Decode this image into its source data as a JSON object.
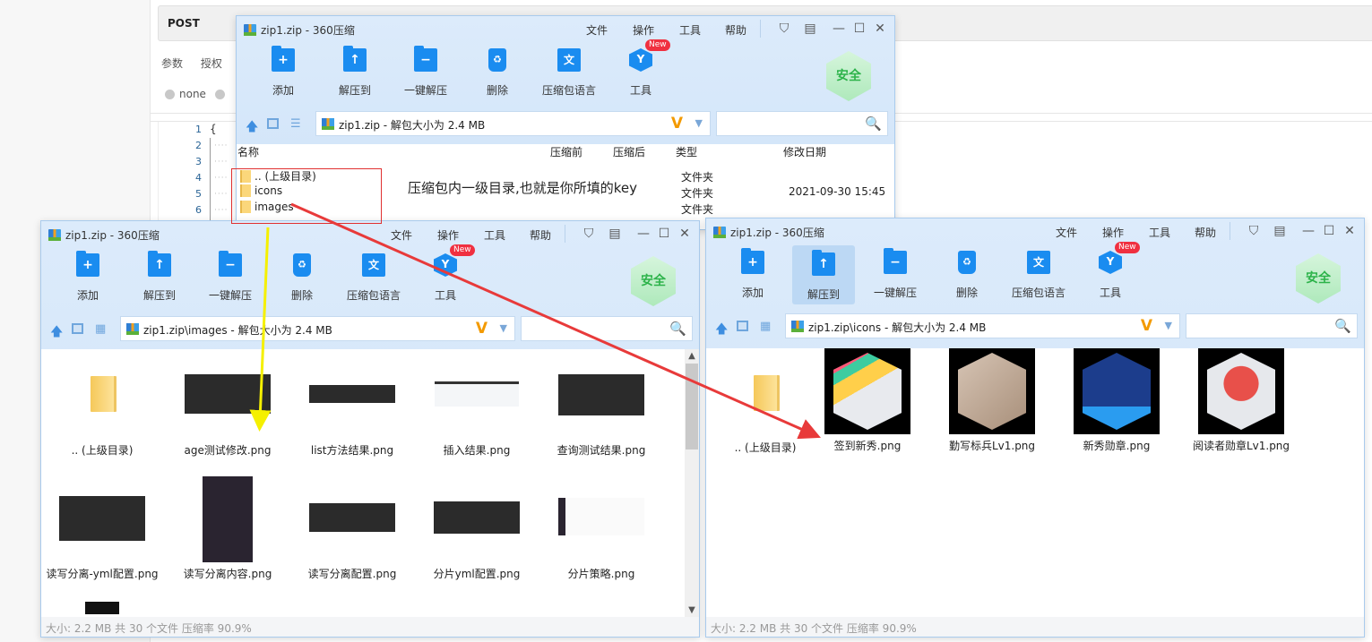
{
  "background": {
    "method": "POST",
    "param_tabs": [
      "参数",
      "授权"
    ],
    "body_radio": "none",
    "line_numbers": [
      "1",
      "2",
      "3",
      "4",
      "5",
      "6"
    ],
    "first_line": "{"
  },
  "windows": {
    "common": {
      "title": "zip1.zip - 360压缩",
      "menu": [
        "文件",
        "操作",
        "工具",
        "帮助"
      ],
      "toolbar": [
        "添加",
        "解压到",
        "一键解压",
        "删除",
        "压缩包语言",
        "工具"
      ],
      "new_badge": "New",
      "safe_badge": "安全",
      "status": "大小: 2.2 MB 共 30 个文件 压缩率 90.9%"
    },
    "root": {
      "address": "zip1.zip - 解包大小为 2.4 MB",
      "columns": [
        "名称",
        "压缩前",
        "压缩后",
        "类型",
        "修改日期"
      ],
      "rows": [
        {
          "name": ".. (上级目录)",
          "type": "文件夹",
          "date": ""
        },
        {
          "name": "icons",
          "type": "文件夹",
          "date": "2021-09-30 15:45"
        },
        {
          "name": "images",
          "type": "文件夹",
          "date": ""
        }
      ]
    },
    "images": {
      "address": "zip1.zip\\images - 解包大小为 2.4 MB",
      "items": [
        ".. (上级目录)",
        "age测试修改.png",
        "list方法结果.png",
        "插入结果.png",
        "查询测试结果.png",
        "读写分离-yml配置.png",
        "读写分离内容.png",
        "读写分离配置.png",
        "分片yml配置.png",
        "分片策略.png"
      ]
    },
    "icons": {
      "address": "zip1.zip\\icons - 解包大小为 2.4 MB",
      "items": [
        ".. (上级目录)",
        "签到新秀.png",
        "勤写标兵Lv1.png",
        "新秀勋章.png",
        "阅读者勋章Lv1.png"
      ]
    }
  },
  "annotation": "压缩包内一级目录,也就是你所填的key",
  "colors": {
    "accent": "#1a8cf0",
    "red_arrow": "#e83a3a",
    "yellow_arrow": "#f5f000",
    "safe_green": "#2db34a"
  }
}
